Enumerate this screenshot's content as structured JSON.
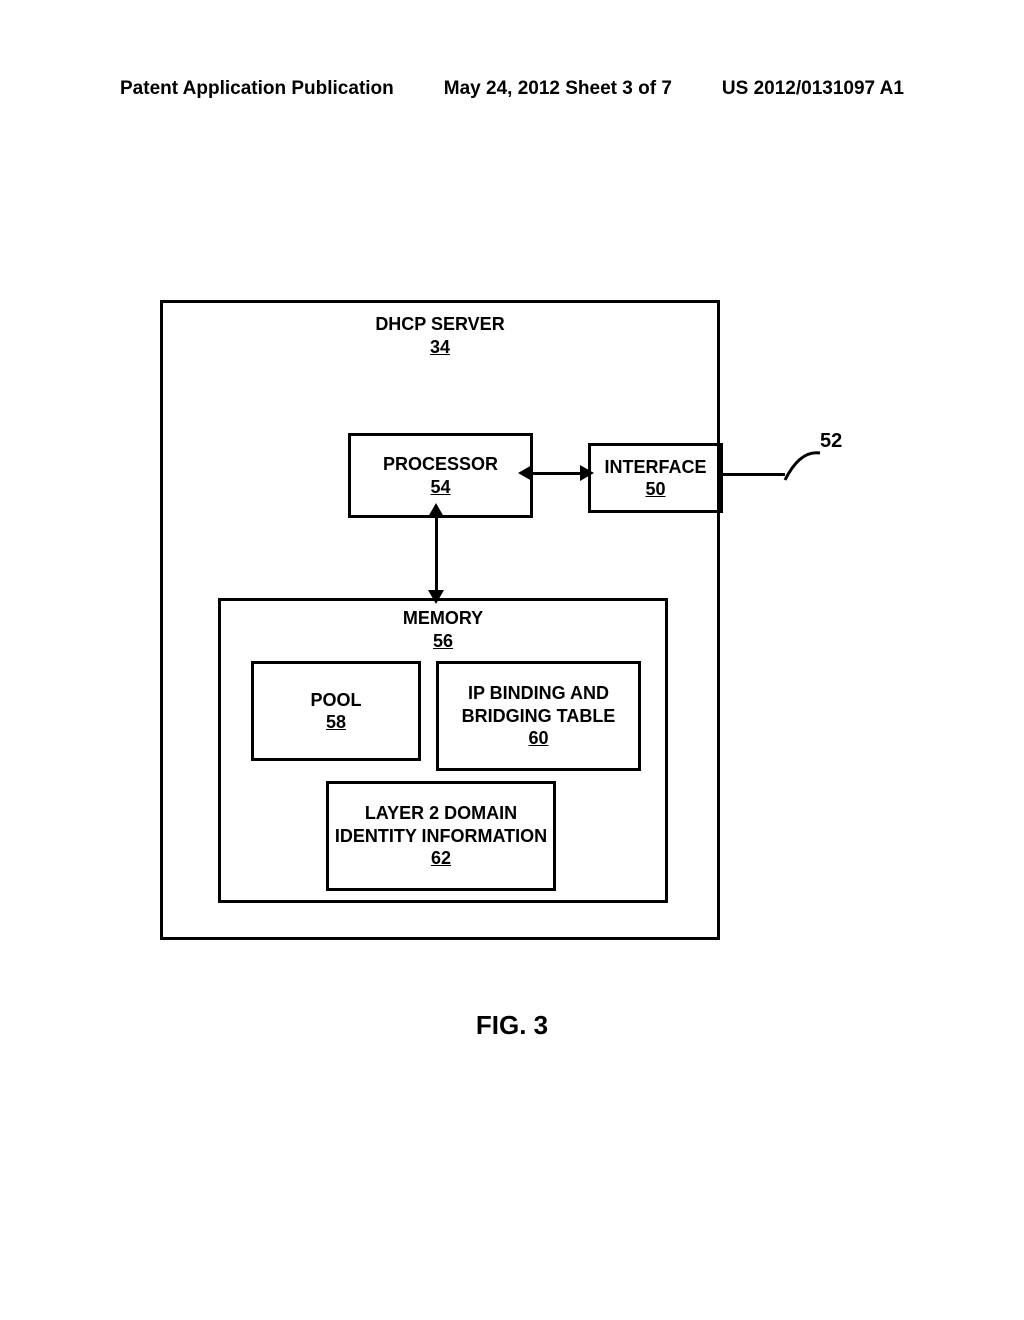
{
  "header": {
    "left": "Patent Application Publication",
    "middle": "May 24, 2012  Sheet 3 of 7",
    "right": "US 2012/0131097 A1"
  },
  "server": {
    "title": "DHCP SERVER",
    "ref": "34"
  },
  "processor": {
    "title": "PROCESSOR",
    "ref": "54"
  },
  "interface": {
    "title": "INTERFACE",
    "ref": "50"
  },
  "memory": {
    "title": "MEMORY",
    "ref": "56"
  },
  "pool": {
    "title": "POOL",
    "ref": "58"
  },
  "binding": {
    "title": "IP BINDING AND BRIDGING TABLE",
    "ref": "60"
  },
  "layer2": {
    "title": "LAYER 2 DOMAIN IDENTITY INFORMATION",
    "ref": "62"
  },
  "external_ref": "52",
  "figure_label": "FIG. 3"
}
